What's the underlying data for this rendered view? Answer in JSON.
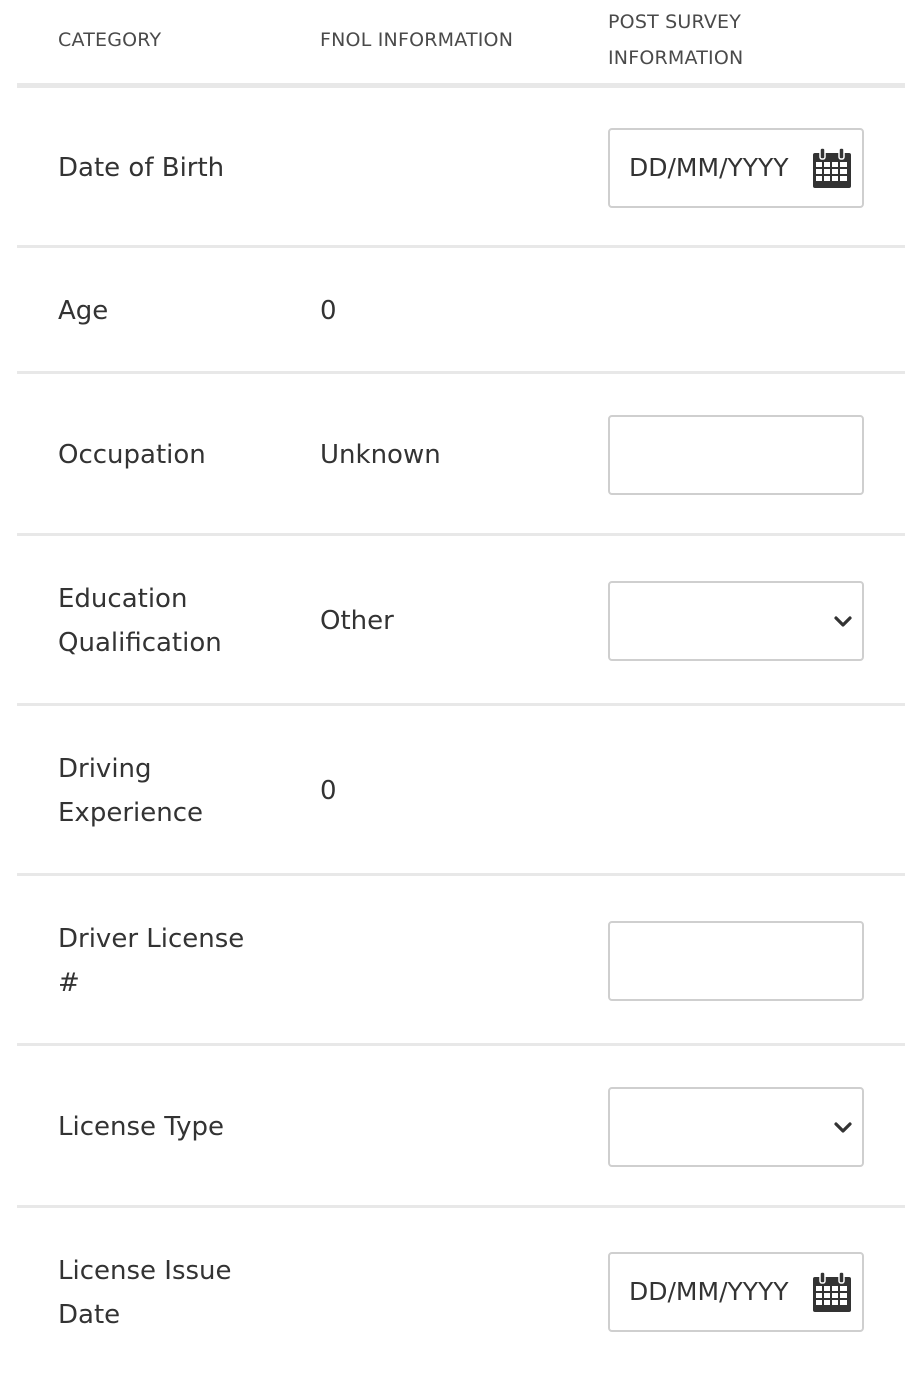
{
  "header": {
    "category": "CATEGORY",
    "fnol": "FNOL INFORMATION",
    "post_survey_line1": "POST SURVEY",
    "post_survey_line2": "INFORMATION"
  },
  "rows": [
    {
      "category": "Date of Birth",
      "fnol": "",
      "field": {
        "type": "date",
        "placeholder": "DD/MM/YYYY",
        "icon": "calendar-icon"
      }
    },
    {
      "category": "Age",
      "fnol": "0",
      "field": null
    },
    {
      "category": "Occupation",
      "fnol": "Unknown",
      "field": {
        "type": "text",
        "value": ""
      }
    },
    {
      "category_line1": "Education",
      "category_line2": "Qualification",
      "fnol": "Other",
      "field": {
        "type": "select",
        "value": "",
        "icon": "chevron-down-icon"
      }
    },
    {
      "category_line1": "Driving",
      "category_line2": "Experience",
      "fnol": "0",
      "field": null
    },
    {
      "category_line1": "Driver License",
      "category_line2": "#",
      "fnol": "",
      "field": {
        "type": "text",
        "value": ""
      }
    },
    {
      "category": "License Type",
      "fnol": "",
      "field": {
        "type": "select",
        "value": "",
        "icon": "chevron-down-icon"
      }
    },
    {
      "category_line1": "License Issue",
      "category_line2": "Date",
      "fnol": "",
      "field": {
        "type": "date",
        "placeholder": "DD/MM/YYYY",
        "icon": "calendar-icon"
      }
    }
  ]
}
